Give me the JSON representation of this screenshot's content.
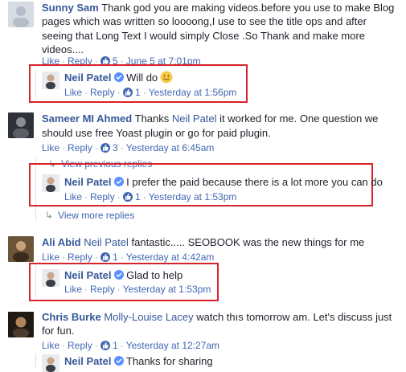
{
  "comments": [
    {
      "author": "Sunny Sam",
      "text_lines": [
        "Thank god you are making videos.before you use to make Blog",
        "pages which was written so loooong,I use to see the title ops and after",
        "seeing that Long Text I would simply Close .So Thank and make more",
        "videos...."
      ],
      "like": "Like",
      "reply": "Reply",
      "likes": "5",
      "time": "June 5 at 7:01pm",
      "reply_item": {
        "author": "Neil Patel",
        "text": "Will do",
        "like": "Like",
        "reply": "Reply",
        "likes": "1",
        "time": "Yesterday at 1:56pm"
      }
    },
    {
      "author": "Sameer MI Ahmed",
      "text_first": "Thanks",
      "mention": "Neil Patel",
      "text_rest": "it worked for me. One question we",
      "text_line2": "should use free Yoast plugin or go for paid plugin.",
      "like": "Like",
      "reply": "Reply",
      "likes": "3",
      "time": "Yesterday at 6:45am",
      "view_previous": "View previous replies",
      "reply_item": {
        "author": "Neil Patel",
        "text": "I prefer the paid because there is a lot more you can do",
        "like": "Like",
        "reply": "Reply",
        "likes": "1",
        "time": "Yesterday at 1:53pm"
      },
      "view_more": "View more replies"
    },
    {
      "author": "Ali Abid",
      "mention": "Neil Patel",
      "text": "fantastic..... SEOBOOK was the new things for me",
      "like": "Like",
      "reply": "Reply",
      "likes": "1",
      "time": "Yesterday at 4:42am",
      "reply_item": {
        "author": "Neil Patel",
        "text": "Glad to help",
        "like": "Like",
        "reply": "Reply",
        "time": "Yesterday at 1:53pm"
      }
    },
    {
      "author": "Chris Burke",
      "mention": "Molly-Louise Lacey",
      "text_rest": "watch thıs tomorrow am. Let's discuss just",
      "text_line2": "for fun.",
      "like": "Like",
      "reply": "Reply",
      "likes": "1",
      "time": "Yesterday at 12:27am",
      "reply_item": {
        "author": "Neil Patel",
        "text": "Thanks for sharing"
      }
    }
  ],
  "colors": {
    "highlight_box": "#d8232a",
    "link": "#365899",
    "action": "#4267b2",
    "muted": "#90949c",
    "verified": "#5890ff"
  },
  "icons": [
    "verified-badge-icon",
    "like-thumb-icon",
    "smiley-emoji-icon",
    "reply-arrow-icon"
  ]
}
